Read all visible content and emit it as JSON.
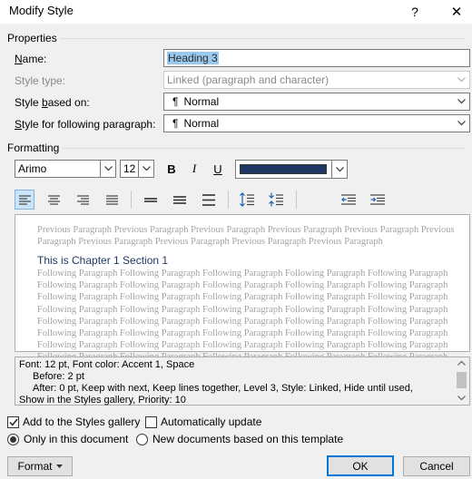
{
  "window": {
    "title": "Modify Style",
    "help": "?",
    "close": "✕"
  },
  "properties": {
    "section_title": "Properties",
    "name_label": "Name:",
    "name_value": "Heading 3",
    "style_type_label": "Style type:",
    "style_type_value": "Linked (paragraph and character)",
    "based_on_label": "Style based on:",
    "based_on_value": "Normal",
    "following_label": "Style for following paragraph:",
    "following_value": "Normal",
    "pilcrow": "¶"
  },
  "formatting": {
    "section_title": "Formatting",
    "font": "Arimo",
    "size": "12",
    "bold": "B",
    "italic": "I",
    "underline": "U",
    "font_color": "#1f3864"
  },
  "preview": {
    "previous_lines": [
      "Previous Paragraph Previous Paragraph Previous Paragraph Previous Paragraph Previous Paragraph Previous",
      "Paragraph Previous Paragraph Previous Paragraph Previous Paragraph Previous Paragraph"
    ],
    "sample": "This is Chapter 1 Section 1",
    "following_lines": [
      "Following Paragraph Following Paragraph Following Paragraph Following Paragraph Following Paragraph",
      "Following Paragraph Following Paragraph Following Paragraph Following Paragraph Following Paragraph",
      "Following Paragraph Following Paragraph Following Paragraph Following Paragraph Following Paragraph",
      "Following Paragraph Following Paragraph Following Paragraph Following Paragraph Following Paragraph",
      "Following Paragraph Following Paragraph Following Paragraph Following Paragraph Following Paragraph",
      "Following Paragraph Following Paragraph Following Paragraph Following Paragraph Following Paragraph",
      "Following Paragraph Following Paragraph Following Paragraph Following Paragraph Following Paragraph",
      "Following Paragraph Following Paragraph Following Paragraph Following Paragraph Following Paragraph"
    ]
  },
  "description": {
    "line1": "Font: 12 pt, Font color: Accent 1, Space",
    "line2": "Before:  2 pt",
    "line3": "After:  0 pt, Keep with next, Keep lines together, Level 3, Style: Linked, Hide until used,",
    "line4": "Show in the Styles gallery, Priority: 10"
  },
  "options": {
    "add_to_gallery": "Add to the Styles gallery",
    "add_to_gallery_checked": true,
    "auto_update": "Automatically update",
    "auto_update_checked": false,
    "only_this_doc": "Only in this document",
    "new_docs": "New documents based on this template",
    "selected_scope": "only_this_doc"
  },
  "buttons": {
    "format": "Format",
    "ok": "OK",
    "cancel": "Cancel"
  }
}
